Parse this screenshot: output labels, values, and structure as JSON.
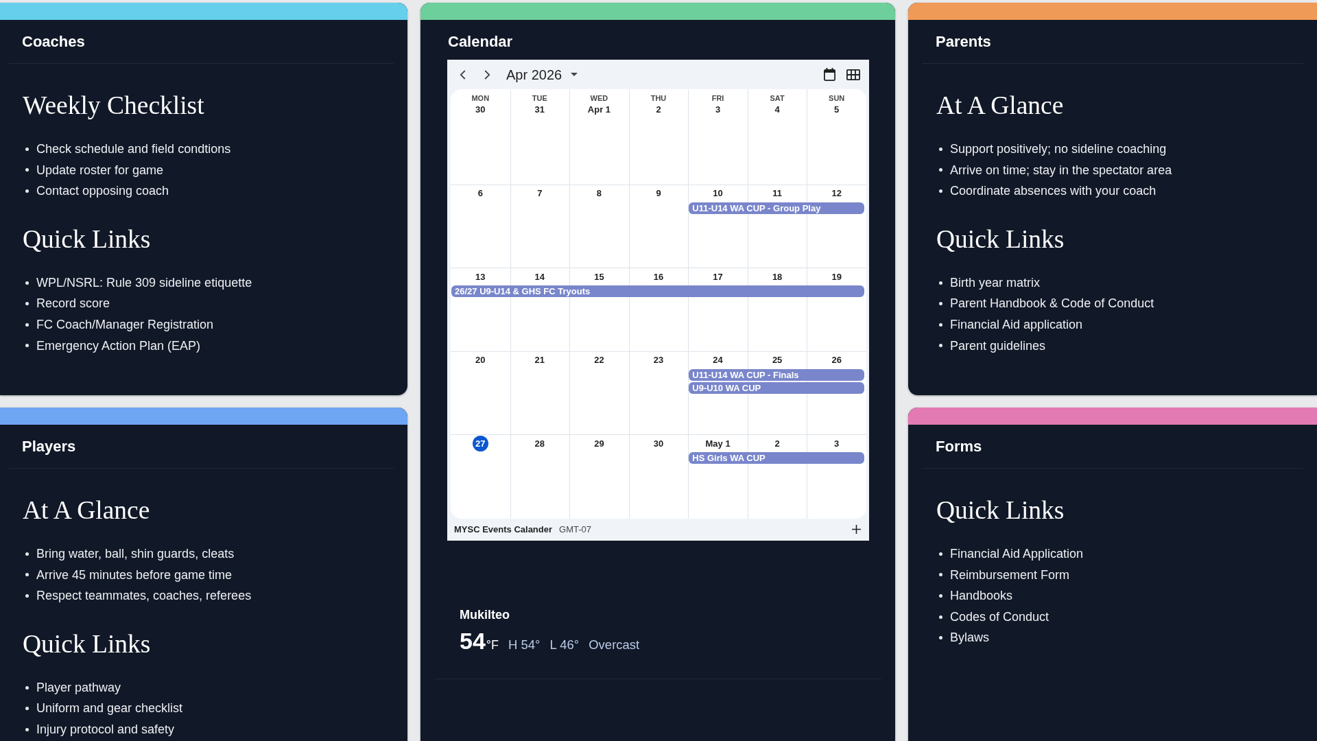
{
  "columns": [
    {
      "cards": [
        {
          "kind": "info",
          "title": "Coaches",
          "color": "#65cfec",
          "sections": [
            {
              "heading": "Weekly Checklist",
              "items": [
                "Check schedule and field condtions",
                "Update roster for game",
                "Contact opposing coach"
              ]
            },
            {
              "heading": "Quick Links",
              "items": [
                "WPL/NSRL: Rule 309 sideline etiquette",
                "Record score",
                "FC Coach/Manager Registration",
                "Emergency Action Plan (EAP)"
              ]
            }
          ]
        },
        {
          "kind": "info",
          "title": "Players",
          "color": "#6ea6f4",
          "sections": [
            {
              "heading": "At A Glance",
              "items": [
                "Bring water, ball, shin guards, cleats",
                "Arrive 45 minutes before game time",
                "Respect teammates, coaches, referees"
              ]
            },
            {
              "heading": "Quick Links",
              "items": [
                "Player pathway",
                "Uniform and gear checklist",
                "Injury protocol and safety"
              ]
            }
          ]
        }
      ]
    },
    {
      "cards": [
        {
          "kind": "calendar",
          "title": "Calendar",
          "color": "#6dcf9b",
          "calendar": {
            "month": "Apr 2026",
            "weekdays": [
              "MON",
              "TUE",
              "WED",
              "THU",
              "FRI",
              "SAT",
              "SUN"
            ],
            "weeks": [
              {
                "days": [
                  {
                    "date": "30",
                    "today": false
                  },
                  {
                    "date": "31",
                    "today": false
                  },
                  {
                    "date": "Apr 1",
                    "today": false
                  },
                  {
                    "date": "2",
                    "today": false
                  },
                  {
                    "date": "3",
                    "today": false
                  },
                  {
                    "date": "4",
                    "today": false
                  },
                  {
                    "date": "5",
                    "today": false
                  }
                ]
              },
              {
                "days": [
                  {
                    "date": "6",
                    "today": false
                  },
                  {
                    "date": "7",
                    "today": false
                  },
                  {
                    "date": "8",
                    "today": false
                  },
                  {
                    "date": "9",
                    "today": false
                  },
                  {
                    "date": "10",
                    "today": false,
                    "events": [
                      {
                        "title": "U11-U14 WA CUP - Group Play",
                        "to_week_end": true
                      }
                    ]
                  },
                  {
                    "date": "11",
                    "today": false
                  },
                  {
                    "date": "12",
                    "today": false
                  }
                ]
              },
              {
                "days": [
                  {
                    "date": "13",
                    "today": false,
                    "events": [
                      {
                        "title": "26/27 U9-U14 & GHS FC Tryouts",
                        "to_week_end": true
                      }
                    ]
                  },
                  {
                    "date": "14",
                    "today": false
                  },
                  {
                    "date": "15",
                    "today": false
                  },
                  {
                    "date": "16",
                    "today": false
                  },
                  {
                    "date": "17",
                    "today": false
                  },
                  {
                    "date": "18",
                    "today": false
                  },
                  {
                    "date": "19",
                    "today": false
                  }
                ]
              },
              {
                "days": [
                  {
                    "date": "20",
                    "today": false
                  },
                  {
                    "date": "21",
                    "today": false
                  },
                  {
                    "date": "22",
                    "today": false
                  },
                  {
                    "date": "23",
                    "today": false
                  },
                  {
                    "date": "24",
                    "today": false,
                    "events": [
                      {
                        "title": "U11-U14 WA CUP - Finals",
                        "to_week_end": true
                      },
                      {
                        "title": "U9-U10 WA CUP",
                        "to_week_end": true
                      }
                    ]
                  },
                  {
                    "date": "25",
                    "today": false
                  },
                  {
                    "date": "26",
                    "today": false
                  }
                ]
              },
              {
                "days": [
                  {
                    "date": "27",
                    "today": true
                  },
                  {
                    "date": "28",
                    "today": false
                  },
                  {
                    "date": "29",
                    "today": false
                  },
                  {
                    "date": "30",
                    "today": false
                  },
                  {
                    "date": "May 1",
                    "today": false,
                    "events": [
                      {
                        "title": "HS Girls WA CUP",
                        "to_week_end": true
                      }
                    ]
                  },
                  {
                    "date": "2",
                    "today": false
                  },
                  {
                    "date": "3",
                    "today": false
                  }
                ]
              }
            ],
            "calendar_name": "MYSC Events Calander",
            "timezone": "GMT-07"
          },
          "weather": {
            "city": "Mukilteo",
            "temperature": "54",
            "unit": "°F",
            "high": "H 54°",
            "low": "L 46°",
            "condition": "Overcast"
          }
        }
      ]
    },
    {
      "cards": [
        {
          "kind": "info",
          "title": "Parents",
          "color": "#f09a57",
          "sections": [
            {
              "heading": "At A Glance",
              "items": [
                "Support positively; no sideline coaching",
                "Arrive on time; stay in the spectator area",
                "Coordinate absences with your coach"
              ]
            },
            {
              "heading": "Quick Links",
              "items": [
                "Birth year matrix",
                "Parent Handbook & Code of Conduct",
                "Financial Aid application",
                "Parent guidelines"
              ]
            }
          ]
        },
        {
          "kind": "info",
          "title": "Forms",
          "color": "#e47ab4",
          "sections": [
            {
              "heading": "Quick Links",
              "items": [
                "Financial Aid Application",
                "Reimbursement Form",
                "Handbooks",
                "Codes of Conduct",
                "Bylaws"
              ]
            }
          ]
        }
      ]
    }
  ]
}
